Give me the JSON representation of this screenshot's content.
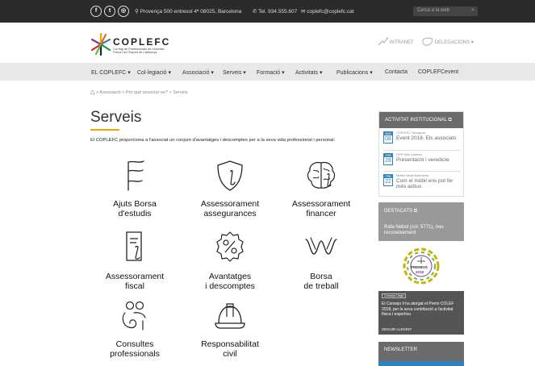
{
  "topbar": {
    "social": [
      {
        "icon": "facebook-icon",
        "glyph": "f"
      },
      {
        "icon": "twitter-icon",
        "glyph": "t"
      },
      {
        "icon": "instagram-icon",
        "glyph": "◎"
      }
    ],
    "address": "Provença 500 entresol 4ª 08025, Barcelona",
    "phone": "Tel. 934.555.607",
    "email": "coplefc@coplefc.cat",
    "search_placeholder": "Cerca a la web"
  },
  "header": {
    "brand": "COPLEFC",
    "subtitle_line1": "Col·legi de Professionals de l'Activitat",
    "subtitle_line2": "Física i de l'Esport de Catalunya",
    "intranet": "INTRANET",
    "delegacions": "DELEGACIONS"
  },
  "nav": {
    "items": [
      {
        "label": "EL COPLEFC",
        "dropdown": true
      },
      {
        "label": "Col·legiació",
        "dropdown": true
      },
      {
        "label": "Associació",
        "dropdown": true
      },
      {
        "label": "Serveis",
        "dropdown": true
      },
      {
        "label": "Formació",
        "dropdown": true
      },
      {
        "label": "Activitats",
        "dropdown": true
      },
      {
        "label": "Publicacions",
        "dropdown": true
      },
      {
        "label": "Contacta",
        "dropdown": false
      },
      {
        "label": "COPLEFCevent",
        "dropdown": false
      }
    ]
  },
  "breadcrumb": {
    "items": [
      "Associació",
      "Per què associar-se?",
      "Serveis"
    ]
  },
  "main": {
    "title": "Serveis",
    "intro": "El COPLEFC proporciona a l'associat un conjunt d'avantatges i descomptes per a la seva vida professional i personal:",
    "services": [
      {
        "label": "Ajuts Borsa\nd'estudis",
        "icon": "scholarship-icon"
      },
      {
        "label": "Assessorament\nassegurances",
        "icon": "insurance-shield-icon"
      },
      {
        "label": "Assessorament\nfinancer",
        "icon": "financial-brain-icon"
      },
      {
        "label": "Assessorament\nfiscal",
        "icon": "tax-document-icon"
      },
      {
        "label": "Avantatges\ni descomptes",
        "icon": "discount-percent-icon"
      },
      {
        "label": "Borsa\nde treball",
        "icon": "job-board-icon"
      },
      {
        "label": "Consultes\nprofessionals",
        "icon": "consultation-people-icon"
      },
      {
        "label": "Responsabilitat\ncivil",
        "icon": "hard-hat-icon"
      }
    ]
  },
  "sidebar": {
    "activitat_title": "ACTIVITAT INSTITUCIONAL",
    "events": [
      {
        "month": "MAR",
        "day": "08",
        "category": "COPLEFC Tarragona",
        "title": "Event 2018. Els associats"
      },
      {
        "month": "FEB",
        "day": "28",
        "category": "FIPP New Leaders",
        "title": "Presentació i veredicte"
      },
      {
        "month": "FEB",
        "day": "22",
        "category": "Mobile Week Barcelona",
        "title": "Com el mòbil ens pot fer més actius"
      }
    ],
    "destacats_title": "DESTACATS",
    "destacat_text": "Rafa Nebot (col. 5771), nou reconeixement",
    "badge_text": "PREMIOS",
    "badge_year": "2018",
    "news_tag": "Consejo Llegir",
    "news_text": "El Consejo li ha atorgat el Premi COLEF 2018, per la seva contribució a l'activitat física i esportiva",
    "news_more": "SEGUIR LLEGINT",
    "newsletter_title": "NEWSLETTER"
  },
  "colors": {
    "topbar": "#2b2b2b",
    "accent": "#f0a500",
    "sidebar_header": "#6b6b6b",
    "event_blue": "#2f82c0"
  }
}
